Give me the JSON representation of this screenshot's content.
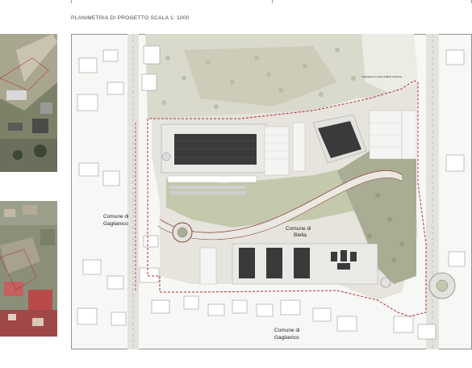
{
  "header": {
    "title": "PLANIMETRIA DI PROGETTO SCALA 1: 1000"
  },
  "plan": {
    "label_comune_gaglianico_west_1": "Comune di",
    "label_comune_gaglianico_west_2": "Gaglianico",
    "label_comune_biella_1": "Comune di",
    "label_comune_biella_2": "Biella",
    "label_comune_gaglianico_south_1": "Comune di",
    "label_comune_gaglianico_south_2": "Gaglianico",
    "label_note_north": "Collegamento pista ciclabile esistente"
  },
  "colors": {
    "boundary": "#b03030",
    "road": "#8a4a3a",
    "vegetation": "#c9cdb0",
    "building_dark": "#3a3a3a",
    "ground": "#e8e6df"
  }
}
